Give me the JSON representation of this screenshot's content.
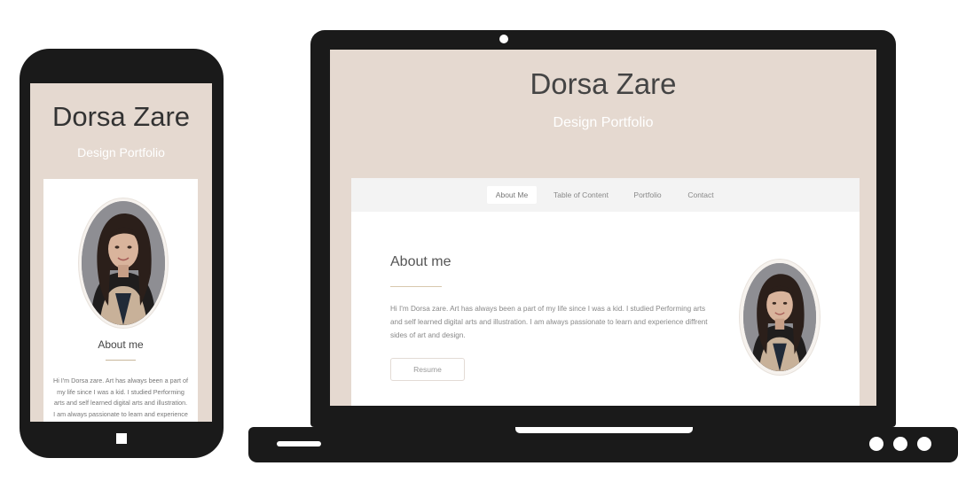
{
  "site": {
    "name": "Dorsa Zare",
    "subtitle": "Design Portfolio"
  },
  "nav": {
    "items": [
      {
        "label": "About Me",
        "active": true
      },
      {
        "label": "Table of Content",
        "active": false
      },
      {
        "label": "Portfolio",
        "active": false
      },
      {
        "label": "Contact",
        "active": false
      }
    ]
  },
  "about": {
    "heading": "About me",
    "mobile_heading": "About me",
    "body": "Hi I'm Dorsa zare. Art has always been a part of my life since I was a kid. I studied Performing arts and self learned digital arts and illustration. I am always passionate to learn and experience diffrent sides of art and design.",
    "resume_label": "Resume"
  },
  "photo": {
    "alt": "portrait-photo"
  },
  "colors": {
    "header_bg": "#e5d9d0",
    "card_bg": "#ffffff",
    "nav_bg": "#f3f3f3",
    "accent_rule": "#c9b79c",
    "device_frame": "#1a1a1a"
  }
}
